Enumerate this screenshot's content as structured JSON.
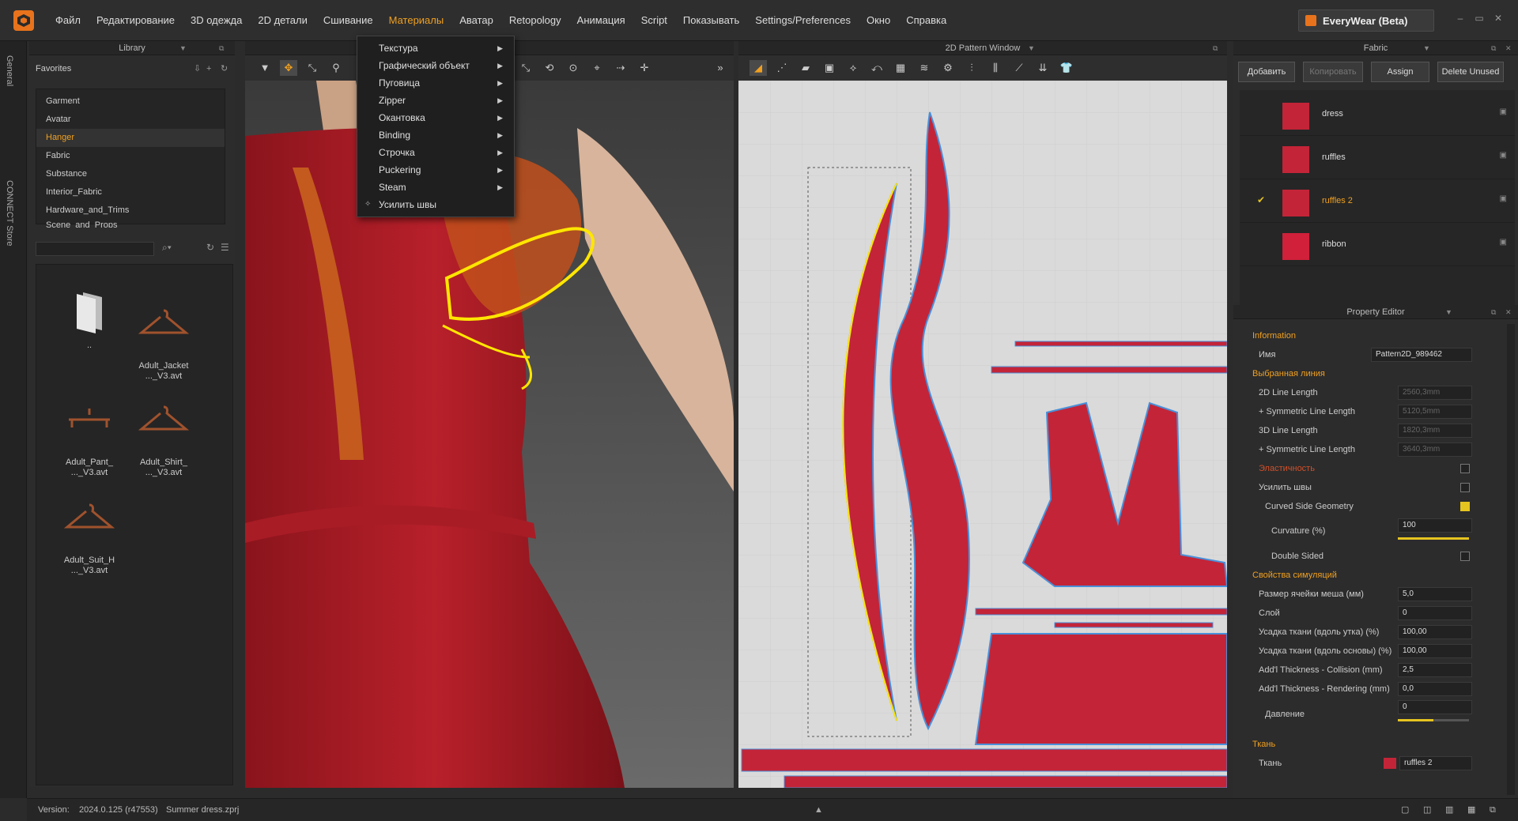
{
  "menubar": {
    "items": [
      "Файл",
      "Редактирование",
      "3D одежда",
      "2D детали",
      "Сшивание",
      "Материалы",
      "Аватар",
      "Retopology",
      "Анимация",
      "Script",
      "Показывать",
      "Settings/Preferences",
      "Окно",
      "Справка"
    ],
    "active_index": 5,
    "brand": "EveryWear (Beta)"
  },
  "sidetabs": {
    "general": "General",
    "connect": "CONNECT Store"
  },
  "library": {
    "title": "Library",
    "favorites_label": "Favorites",
    "favorites": [
      "Garment",
      "Avatar",
      "Hanger",
      "Fabric",
      "Substance",
      "Interior_Fabric",
      "Hardware_and_Trims",
      "Scene_and_Props"
    ],
    "selected_favorite": "Hanger",
    "files": [
      {
        "name": "..",
        "icon": "folder-icon"
      },
      {
        "name": "Adult_Jacket\n..._V3.avt",
        "icon": "hanger-icon"
      },
      {
        "name": "Adult_Pant_\n..._V3.avt",
        "icon": "pant-hanger-icon"
      },
      {
        "name": "Adult_Shirt_\n..._V3.avt",
        "icon": "hanger-icon"
      },
      {
        "name": "Adult_Suit_H\n..._V3.avt",
        "icon": "hanger-icon"
      }
    ]
  },
  "materials_menu": {
    "items": [
      {
        "label": "Текстура",
        "submenu": true
      },
      {
        "label": "Графический объект",
        "submenu": true
      },
      {
        "label": "Пуговица",
        "submenu": true
      },
      {
        "label": "Zipper",
        "submenu": true
      },
      {
        "label": "Окантовка",
        "submenu": true
      },
      {
        "label": "Binding",
        "submenu": true
      },
      {
        "label": "Строчка",
        "submenu": true
      },
      {
        "label": "Puckering",
        "submenu": true
      },
      {
        "label": "Steam",
        "submenu": true
      },
      {
        "label": "Усилить швы",
        "submenu": false
      }
    ]
  },
  "pattern2d": {
    "title": "2D Pattern Window"
  },
  "fabric": {
    "title": "Fabric",
    "buttons": {
      "add": "Добавить",
      "copy": "Копировать",
      "assign": "Assign",
      "delete": "Delete Unused"
    },
    "items": [
      "dress",
      "ruffles",
      "ruffles 2",
      "ribbon"
    ],
    "selected": "ruffles 2",
    "swatch_color": "#c32438"
  },
  "property_editor": {
    "title": "Property Editor",
    "information": "Information",
    "name_label": "Имя",
    "name_value": "Pattern2D_989462",
    "selected_line": "Выбранная линия",
    "line2d_label": "2D Line Length",
    "line2d_value": "2560,3mm",
    "sym2d_label": "+ Symmetric Line Length",
    "sym2d_value": "5120,5mm",
    "line3d_label": "3D Line Length",
    "line3d_value": "1820,3mm",
    "sym3d_label": "+ Symmetric Line Length",
    "sym3d_value": "3640,3mm",
    "elasticity": "Эластичность",
    "reinforce": "Усилить швы",
    "curved": "Curved Side Geometry",
    "curvature_label": "Curvature (%)",
    "curvature_value": "100",
    "curvature_fill": 1.0,
    "double_sided": "Double Sided",
    "sim_props": "Свойства симуляций",
    "mesh_label": "Размер ячейки меша (мм)",
    "mesh_value": "5,0",
    "layer_label": "Слой",
    "layer_value": "0",
    "shrink_weft_label": "Усадка ткани (вдоль утка) (%)",
    "shrink_weft_value": "100,00",
    "shrink_warp_label": "Усадка ткани (вдоль основы) (%)",
    "shrink_warp_value": "100,00",
    "thick_col_label": "Add'l Thickness - Collision (mm)",
    "thick_col_value": "2,5",
    "thick_ren_label": "Add'l Thickness - Rendering (mm)",
    "thick_ren_value": "0,0",
    "pressure_label": "Давление",
    "pressure_value": "0",
    "pressure_fill": 0.5,
    "fabric_section": "Ткань",
    "fabric_label": "Ткань",
    "fabric_value": "ruffles 2"
  },
  "status": {
    "version_label": "Version:",
    "version": "2024.0.125 (r47553)",
    "file": "Summer dress.zprj"
  }
}
